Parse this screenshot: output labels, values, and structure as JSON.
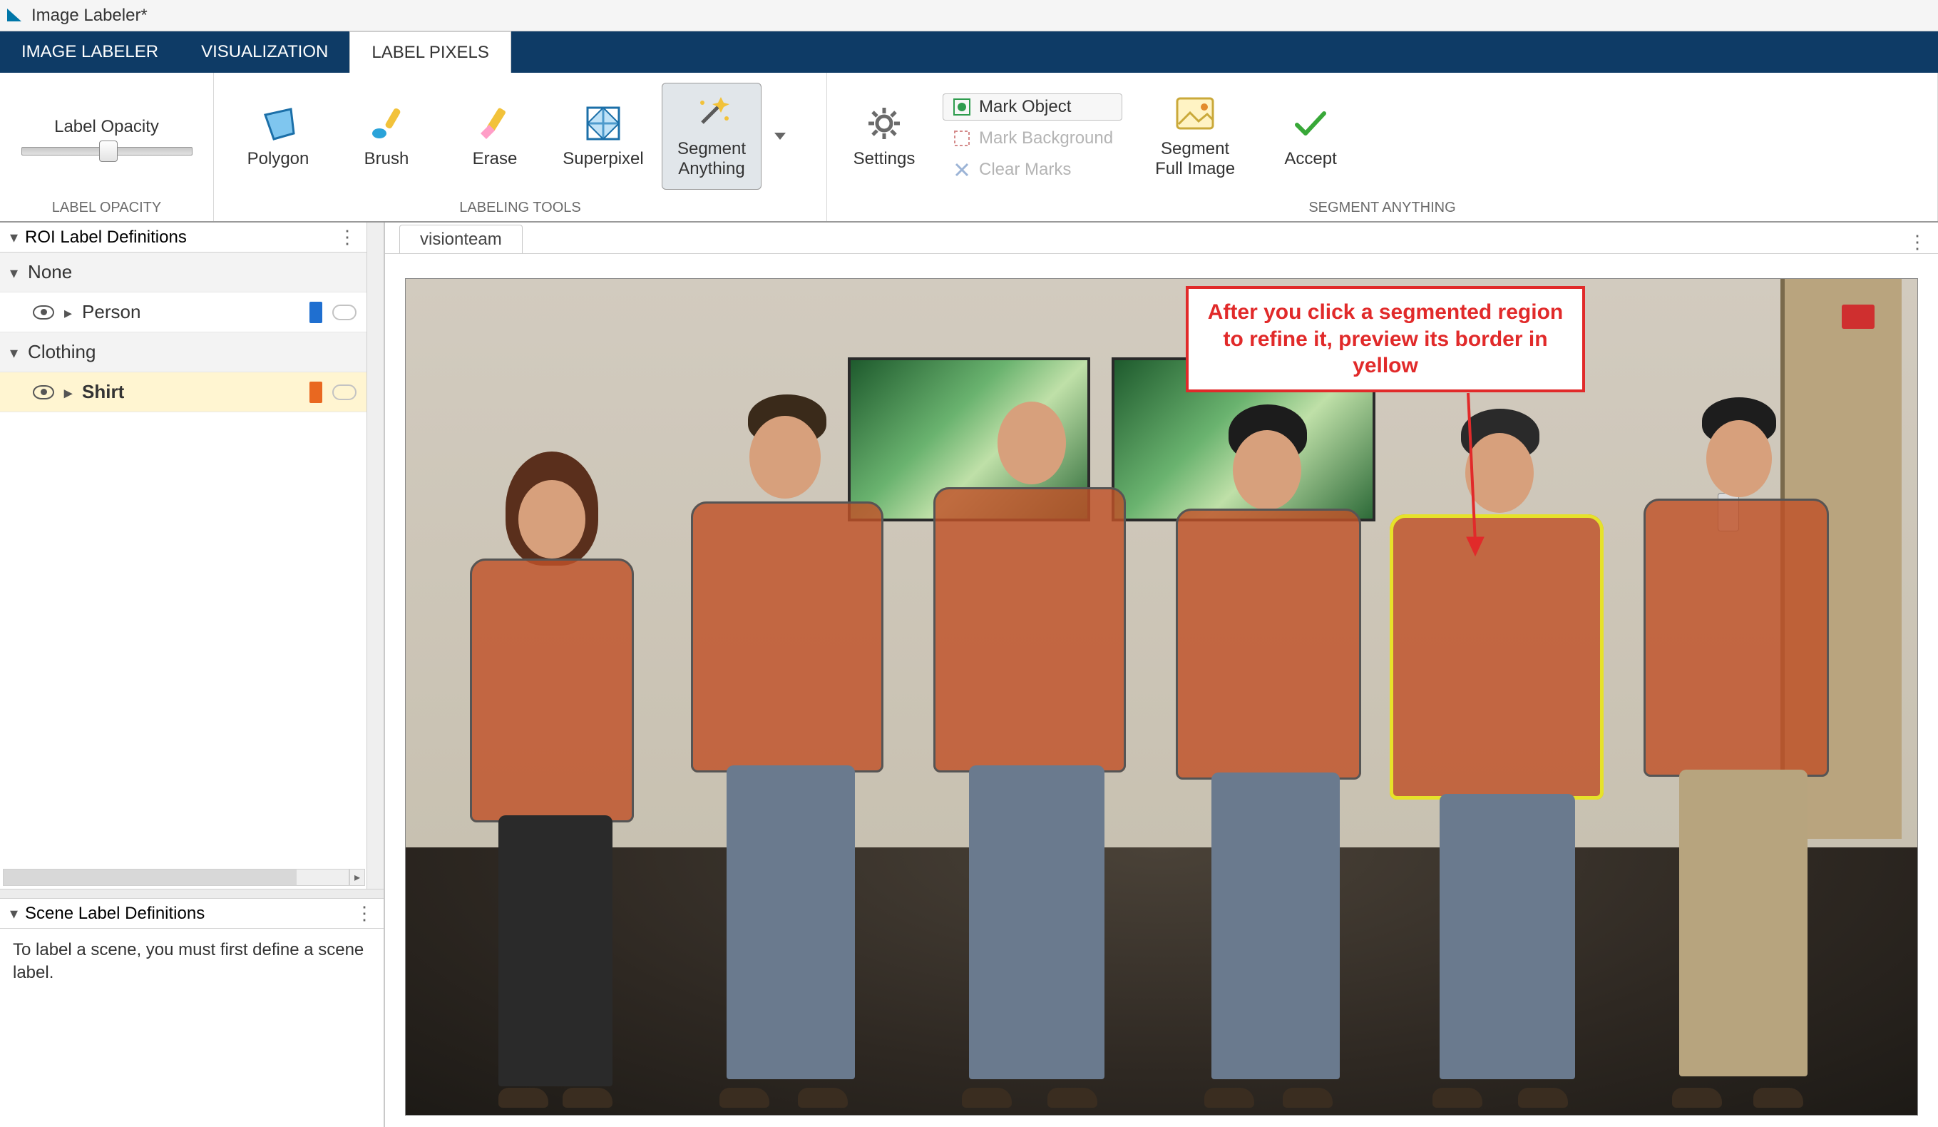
{
  "window": {
    "title": "Image Labeler*"
  },
  "tabs": {
    "imageLabeler": "IMAGE LABELER",
    "visualization": "VISUALIZATION",
    "labelPixels": "LABEL PIXELS"
  },
  "toolstrip": {
    "labelOpacity": {
      "label": "Label Opacity",
      "section": "LABEL OPACITY"
    },
    "labelingTools": {
      "section": "LABELING TOOLS",
      "polygon": "Polygon",
      "brush": "Brush",
      "erase": "Erase",
      "superpixel": "Superpixel",
      "segmentAnything": "Segment\nAnything"
    },
    "segmentAnythingGroup": {
      "section": "SEGMENT ANYTHING",
      "settings": "Settings",
      "markObject": "Mark Object",
      "markBackground": "Mark Background",
      "clearMarks": "Clear Marks",
      "segmentFullImage": "Segment\nFull Image",
      "accept": "Accept"
    }
  },
  "leftPanel": {
    "roiHeader": "ROI Label Definitions",
    "groupNone": "None",
    "labelPerson": "Person",
    "groupClothing": "Clothing",
    "labelShirt": "Shirt",
    "sceneHeader": "Scene Label Definitions",
    "sceneHelp": "To label a scene, you must first define a scene label."
  },
  "document": {
    "tabName": "visionteam"
  },
  "callout": {
    "text": "After you click a segmented region to refine it, preview its border in yellow"
  }
}
